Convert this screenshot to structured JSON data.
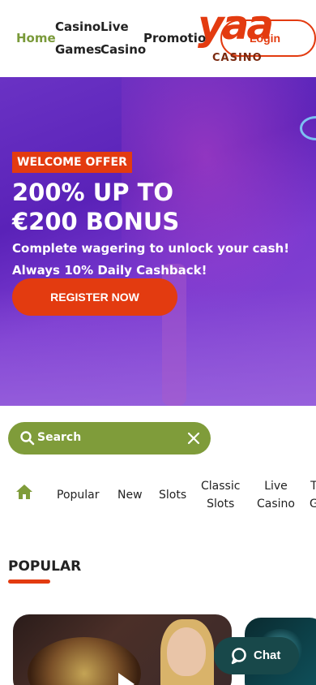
{
  "header": {
    "nav": {
      "home": "Home",
      "casino": "Casino",
      "live": "Live",
      "games": "Games",
      "casino2": "Casino",
      "promotions": "Promotio"
    },
    "login_label": "Login",
    "logo": {
      "brand": "yaa",
      "sub": "CASINO"
    }
  },
  "hero": {
    "badge": "WELCOME OFFER",
    "title_line1": "200% UP TO",
    "title_line2": "€200 BONUS",
    "sub_line1": "Complete wagering to unlock your cash!",
    "sub_line2": "Always 10% Daily Cashback!",
    "cta": "REGISTER NOW"
  },
  "search": {
    "label": "Search",
    "icon": "search-icon",
    "clear_icon": "close-icon"
  },
  "categories": {
    "home_icon": "home-icon",
    "items": [
      {
        "label": "Popular"
      },
      {
        "label": "New"
      },
      {
        "label": "Slots"
      },
      {
        "label_l1": "Classic",
        "label_l2": "Slots"
      },
      {
        "label_l1": "Live",
        "label_l2": "Casino"
      },
      {
        "label_l1": "T",
        "label_l2": "G"
      }
    ]
  },
  "popular": {
    "title": "POPULAR"
  },
  "chat": {
    "label": "Chat",
    "icon": "chat-bubble-icon"
  },
  "colors": {
    "accent": "#e33b10",
    "green": "#7f9c3a",
    "hero_purple": "#6a32c4",
    "chat_bg": "#18484a"
  }
}
